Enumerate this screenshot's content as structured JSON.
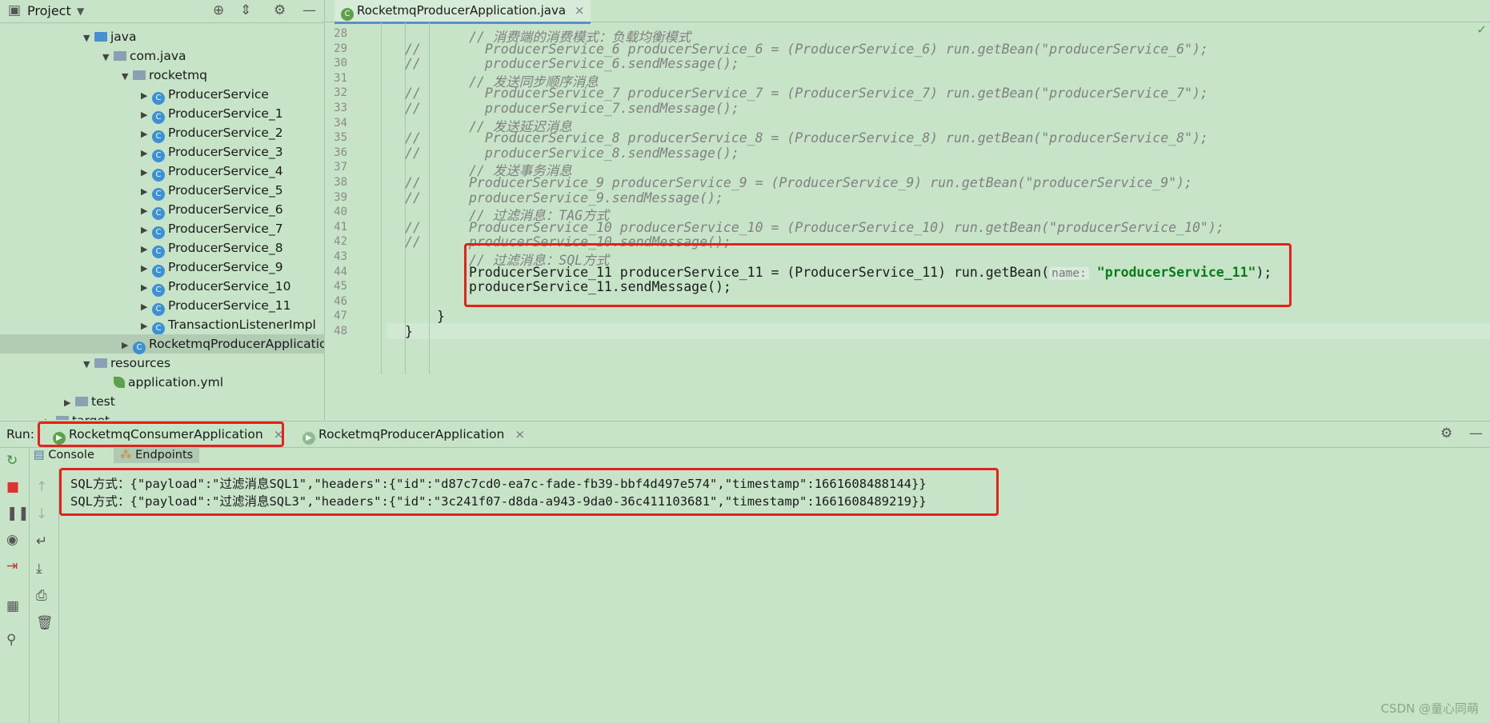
{
  "project_panel": {
    "title": "Project",
    "tree": [
      {
        "label": "java",
        "indent": 1,
        "expanded": true,
        "icon": "folder-icon"
      },
      {
        "label": "com.java",
        "indent": 2,
        "expanded": true,
        "icon": "package-icon"
      },
      {
        "label": "rocketmq",
        "indent": 3,
        "expanded": true,
        "icon": "package-icon"
      },
      {
        "label": "ProducerService",
        "indent": 4,
        "icon": "class-icon"
      },
      {
        "label": "ProducerService_1",
        "indent": 4,
        "icon": "class-icon"
      },
      {
        "label": "ProducerService_2",
        "indent": 4,
        "icon": "class-icon"
      },
      {
        "label": "ProducerService_3",
        "indent": 4,
        "icon": "class-icon"
      },
      {
        "label": "ProducerService_4",
        "indent": 4,
        "icon": "class-icon"
      },
      {
        "label": "ProducerService_5",
        "indent": 4,
        "icon": "class-icon"
      },
      {
        "label": "ProducerService_6",
        "indent": 4,
        "icon": "class-icon"
      },
      {
        "label": "ProducerService_7",
        "indent": 4,
        "icon": "class-icon"
      },
      {
        "label": "ProducerService_8",
        "indent": 4,
        "icon": "class-icon"
      },
      {
        "label": "ProducerService_9",
        "indent": 4,
        "icon": "class-icon"
      },
      {
        "label": "ProducerService_10",
        "indent": 4,
        "icon": "class-icon"
      },
      {
        "label": "ProducerService_11",
        "indent": 4,
        "icon": "class-icon"
      },
      {
        "label": "TransactionListenerImpl",
        "indent": 4,
        "icon": "class-icon"
      },
      {
        "label": "RocketmqProducerApplication",
        "indent": 3,
        "icon": "spring-class-icon",
        "selected": true
      },
      {
        "label": "resources",
        "indent": 1,
        "expanded": true,
        "icon": "folder-icon"
      },
      {
        "label": "application.yml",
        "indent": 2,
        "icon": "spring-leaf-icon"
      },
      {
        "label": "test",
        "indent": 0,
        "icon": "folder-icon"
      },
      {
        "label": "target",
        "indent": -1,
        "icon": "folder-icon"
      }
    ]
  },
  "editor": {
    "tab_label": "RocketmqProducerApplication.java",
    "lines": [
      {
        "n": "28",
        "prefix": "",
        "text": "// 消费端的消费模式：负载均衡模式",
        "kind": "comment"
      },
      {
        "n": "29",
        "prefix": "//",
        "text": "  ProducerService_6 producerService_6 = (ProducerService_6) run.getBean(\"producerService_6\");",
        "kind": "comment"
      },
      {
        "n": "30",
        "prefix": "//",
        "text": "  producerService_6.sendMessage();",
        "kind": "comment"
      },
      {
        "n": "31",
        "prefix": "",
        "text": "// 发送同步顺序消息",
        "kind": "comment"
      },
      {
        "n": "32",
        "prefix": "//",
        "text": "  ProducerService_7 producerService_7 = (ProducerService_7) run.getBean(\"producerService_7\");",
        "kind": "comment"
      },
      {
        "n": "33",
        "prefix": "//",
        "text": "  producerService_7.sendMessage();",
        "kind": "comment"
      },
      {
        "n": "34",
        "prefix": "",
        "text": "// 发送延迟消息",
        "kind": "comment"
      },
      {
        "n": "35",
        "prefix": "//",
        "text": "  ProducerService_8 producerService_8 = (ProducerService_8) run.getBean(\"producerService_8\");",
        "kind": "comment"
      },
      {
        "n": "36",
        "prefix": "//",
        "text": "  producerService_8.sendMessage();",
        "kind": "comment"
      },
      {
        "n": "37",
        "prefix": "",
        "text": "// 发送事务消息",
        "kind": "comment"
      },
      {
        "n": "38",
        "prefix": "//",
        "text": "ProducerService_9 producerService_9 = (ProducerService_9) run.getBean(\"producerService_9\");",
        "kind": "comment"
      },
      {
        "n": "39",
        "prefix": "//",
        "text": "producerService_9.sendMessage();",
        "kind": "comment"
      },
      {
        "n": "40",
        "prefix": "",
        "text": "// 过滤消息：TAG方式",
        "kind": "comment"
      },
      {
        "n": "41",
        "prefix": "//",
        "text": "ProducerService_10 producerService_10 = (ProducerService_10) run.getBean(\"producerService_10\");",
        "kind": "comment"
      },
      {
        "n": "42",
        "prefix": "//",
        "text": "producerService_10.sendMessage();",
        "kind": "comment"
      },
      {
        "n": "43",
        "prefix": "",
        "text": "// 过滤消息：SQL方式",
        "kind": "comment"
      },
      {
        "n": "44",
        "prefix": "",
        "text": "ProducerService_11 producerService_11 = (ProducerService_11) run.getBean(",
        "kind": "code",
        "hint": "name:",
        "string": "\"producerService_11\"",
        "tail": ");"
      },
      {
        "n": "45",
        "prefix": "",
        "text": "producerService_11.sendMessage();",
        "kind": "code"
      },
      {
        "n": "46",
        "prefix": "",
        "text": "",
        "kind": "code"
      },
      {
        "n": "47",
        "prefix": "",
        "text": "}",
        "kind": "brace1"
      },
      {
        "n": "48",
        "prefix": "",
        "text": "}",
        "kind": "brace0"
      }
    ]
  },
  "run_panel": {
    "label": "Run:",
    "tabs": [
      "RocketmqConsumerApplication",
      "RocketmqProducerApplication"
    ],
    "console_tab": "Console",
    "endpoints_tab": "Endpoints",
    "output": [
      "SQL方式：{\"payload\":\"过滤消息SQL1\",\"headers\":{\"id\":\"d87c7cd0-ea7c-fade-fb39-bbf4d497e574\",\"timestamp\":1661608488144}}",
      "SQL方式：{\"payload\":\"过滤消息SQL3\",\"headers\":{\"id\":\"3c241f07-d8da-a943-9da0-36c411103681\",\"timestamp\":1661608489219}}"
    ]
  },
  "watermark": "CSDN @童心同萌",
  "colors": {
    "background": "#c7e4c9",
    "highlight_box": "#e2221b",
    "string": "#067d17"
  }
}
